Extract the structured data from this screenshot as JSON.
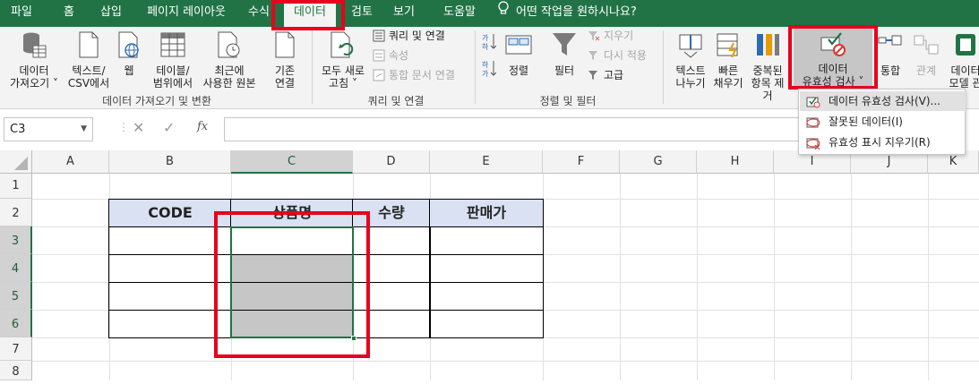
{
  "tabs": [
    "파일",
    "홈",
    "삽입",
    "페이지 레이아웃",
    "수식",
    "데이터",
    "검토",
    "보기",
    "도움말"
  ],
  "tell_me": "어떤 작업을 원하시나요?",
  "ribbon": {
    "get_data": [
      "데이터",
      "가져오기 ˅"
    ],
    "from_text": [
      "텍스트/",
      "CSV에서"
    ],
    "web": [
      "웹"
    ],
    "from_table": [
      "테이블/",
      "범위에서"
    ],
    "recent_sources": [
      "최근에",
      "사용한 원본"
    ],
    "existing_conn": [
      "기존",
      "연결"
    ],
    "group_get": "데이터 가져오기 및 변환",
    "refresh_all": [
      "모두 새로",
      "고침 ˅"
    ],
    "queries_conn": "쿼리 및 연결",
    "properties": "속성",
    "edit_links": "통합 문서 연결",
    "group_queries": "쿼리 및 연결",
    "sort": "정렬",
    "filter": "필터",
    "clear": "지우기",
    "reapply": "다시 적용",
    "advanced": "고급",
    "group_sort": "정렬 및 필터",
    "text_to_columns": [
      "텍스트",
      "나누기"
    ],
    "flash_fill": [
      "빠른",
      "채우기"
    ],
    "remove_dup": [
      "중복된",
      "항목 제거"
    ],
    "data_validation": [
      "데이터",
      "유효성 검사 ˅"
    ],
    "consolidate": "통합",
    "relationships": "관계",
    "data_model": [
      "데이터",
      "모델 관"
    ]
  },
  "name_box": "C3",
  "fx": "fx",
  "columns": [
    "A",
    "B",
    "C",
    "D",
    "E",
    "F",
    "G",
    "H",
    "I",
    "J",
    "K"
  ],
  "rows": [
    "1",
    "2",
    "3",
    "4",
    "5",
    "6",
    "7",
    "8"
  ],
  "table_headers": [
    "CODE",
    "상품명",
    "수량",
    "판매가"
  ],
  "dropdown": {
    "items": [
      "데이터 유효성 검사(V)...",
      "잘못된 데이터(I)",
      "유효성 표시 지우기(R)"
    ]
  },
  "colors": {
    "accent": "#217346",
    "highlight": "#e8001c",
    "header_fill": "#d9e1f2",
    "selection_fill": "#c6c6c6"
  }
}
